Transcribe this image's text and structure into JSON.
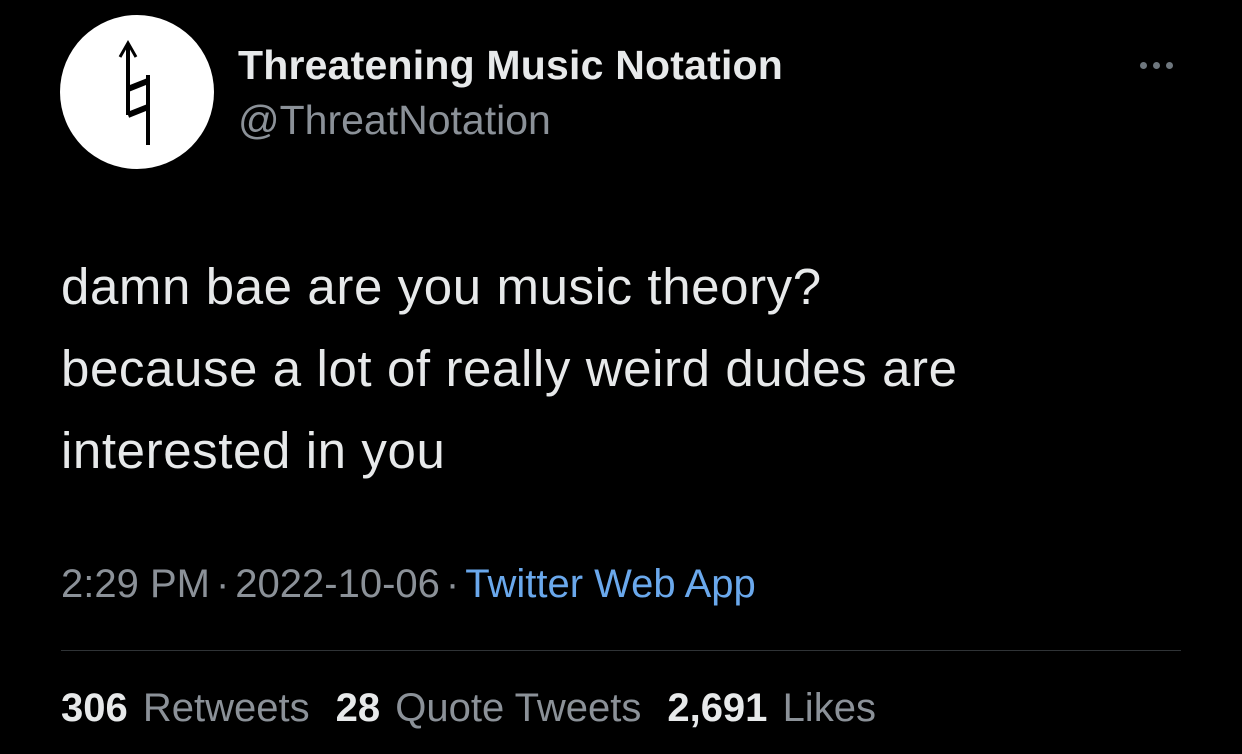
{
  "tweet": {
    "author": {
      "display_name": "Threatening Music Notation",
      "handle": "@ThreatNotation",
      "avatar_icon": "arrow-natural-sign-icon"
    },
    "more_icon": "more-dots-icon",
    "body_lines": [
      "damn bae are you music theory?",
      "because a lot of really weird dudes are",
      "interested in you"
    ],
    "meta": {
      "time": "2:29 PM",
      "date": "2022-10-06",
      "separator": "·",
      "source": "Twitter Web App"
    },
    "stats": {
      "retweets_count": "306",
      "retweets_label": "Retweets",
      "quotes_count": "28",
      "quotes_label": "Quote Tweets",
      "likes_count": "2,691",
      "likes_label": "Likes"
    }
  },
  "colors": {
    "background": "#000000",
    "primary_text": "#e7e9ea",
    "secondary_text": "#8b9198",
    "link": "#6aa8ec",
    "divider": "#2f3336"
  }
}
